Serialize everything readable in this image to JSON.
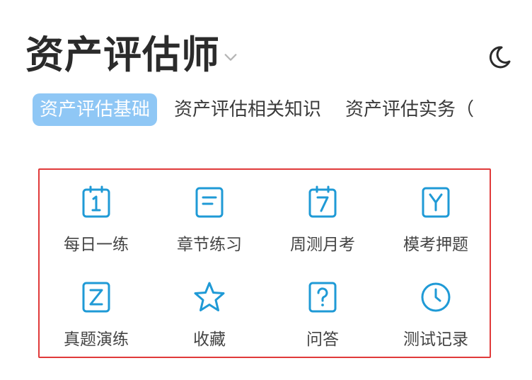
{
  "header": {
    "title": "资产评估师",
    "chevron_icon": "chevron-down-icon",
    "theme_icon": "moon-icon"
  },
  "tabs": [
    {
      "label": "资产评估基础",
      "active": true
    },
    {
      "label": "资产评估相关知识",
      "active": false
    },
    {
      "label": "资产评估实务（",
      "active": false
    }
  ],
  "menu": {
    "items": [
      {
        "label": "每日一练",
        "icon": "calendar-1-icon"
      },
      {
        "label": "章节练习",
        "icon": "document-lines-icon"
      },
      {
        "label": "周测月考",
        "icon": "calendar-7-icon"
      },
      {
        "label": "模考押题",
        "icon": "letter-y-icon"
      },
      {
        "label": "真题演练",
        "icon": "letter-z-icon"
      },
      {
        "label": "收藏",
        "icon": "star-icon"
      },
      {
        "label": "问答",
        "icon": "question-icon"
      },
      {
        "label": "测试记录",
        "icon": "clock-icon"
      }
    ]
  },
  "colors": {
    "accent": "#1f9ad6",
    "tab_active_bg": "#8fc7f5",
    "highlight_border": "#e03a3a"
  }
}
